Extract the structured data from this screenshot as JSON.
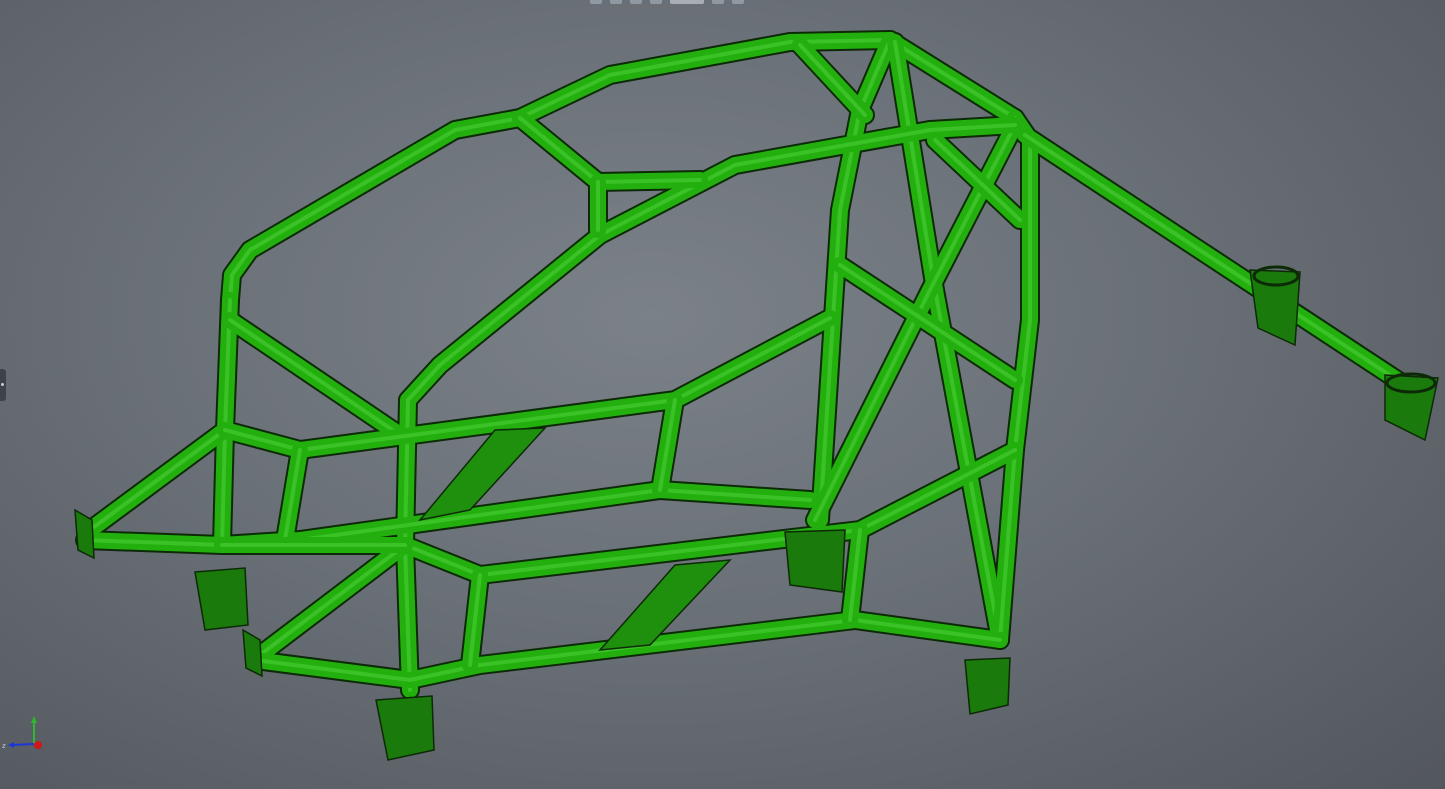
{
  "window": {
    "title": ""
  },
  "toolbar": {
    "buttons": [
      {
        "name": "view-orientation-icon"
      },
      {
        "name": "zoom-to-fit-icon"
      },
      {
        "name": "section-view-icon"
      },
      {
        "name": "display-style-icon"
      },
      {
        "name": "hide-show-icon"
      },
      {
        "name": "appearance-icon"
      },
      {
        "name": "scene-icon"
      }
    ]
  },
  "colors": {
    "tube_fill": "#23b00f",
    "tube_shade": "#1a7a0c",
    "tube_edge": "#0d2a06",
    "gusset_fill": "#1f8f0e",
    "background_center": "#7b8188",
    "background_edge": "#52575d"
  },
  "model": {
    "description_icon": "roll-cage-model"
  },
  "triad": {
    "x_axis_color": "#d01818",
    "y_axis_color": "#2fb92f",
    "z_axis_color": "#1c36d8"
  }
}
